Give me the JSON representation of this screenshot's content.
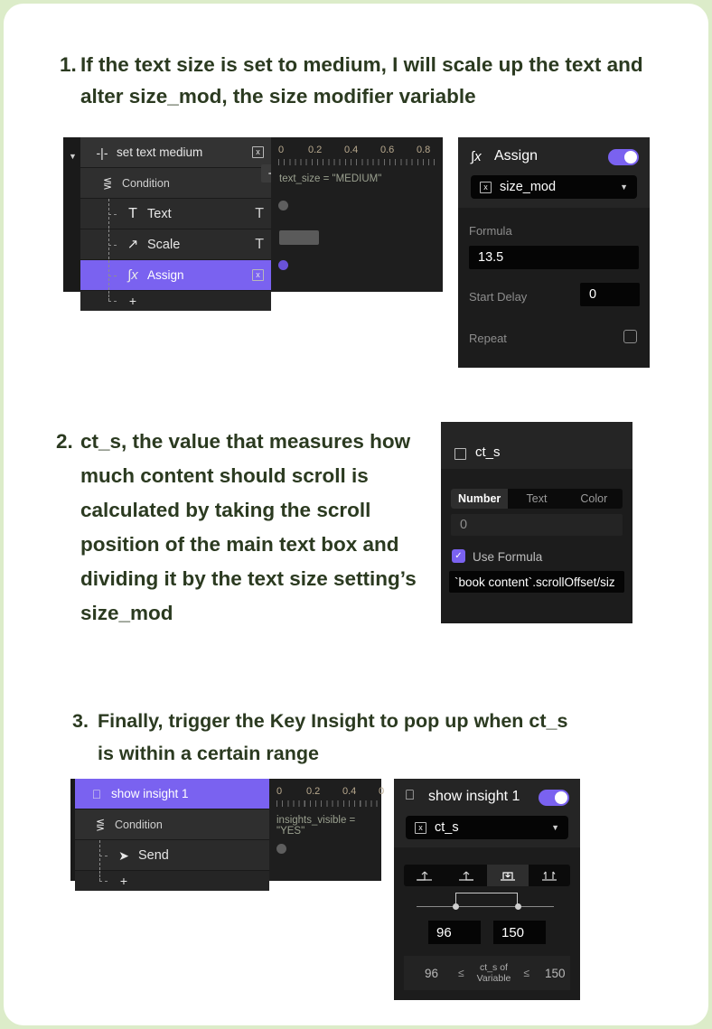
{
  "steps": [
    {
      "num": "1.",
      "text": "If the text size is set to medium, I will scale up the text and alter size_mod, the size modifier variable"
    },
    {
      "num": "2.",
      "text": "ct_s, the value that measures how much content should scroll is calculated by taking the scroll position of the main text box and dividing it by the text size setting’s size_mod"
    },
    {
      "num": "3.",
      "text": "Finally, trigger the Key Insight to pop up when ct_s is within a certain range"
    }
  ],
  "panel1": {
    "tree": {
      "caret": "▼",
      "rows": [
        {
          "icon": "-|-",
          "label": "set text medium",
          "tail_box": "x"
        },
        {
          "icon": "condition-icon",
          "label": "Condition"
        },
        {
          "icon": "T",
          "label": "Text",
          "tail": "T"
        },
        {
          "icon": "↗",
          "label": "Scale",
          "tail": "T"
        },
        {
          "icon": "∫x",
          "label": "Assign",
          "tail_box": "x"
        }
      ],
      "add_label": "+",
      "add_button_label": "+"
    },
    "ruler": {
      "ticks": [
        "0",
        "0.2",
        "0.4",
        "0.6",
        "0.8"
      ]
    },
    "condition_text": "text_size = \"MEDIUM\""
  },
  "assign_inspector": {
    "icon": "∫x",
    "title": "Assign",
    "toggle_on": true,
    "variable": "size_mod",
    "formula_label": "Formula",
    "formula_value": "13.5",
    "start_delay_label": "Start Delay",
    "start_delay_value": "0",
    "repeat_label": "Repeat",
    "repeat_checked": false
  },
  "cts_inspector": {
    "title": "ct_s",
    "tabs": [
      "Number",
      "Text",
      "Color"
    ],
    "active_tab": "Number",
    "value": "0",
    "use_formula_label": "Use Formula",
    "use_formula_checked": true,
    "formula_value": "`book content`.scrollOffset/siz"
  },
  "panel3": {
    "tree": {
      "rows": [
        {
          "icon": "insight-icon",
          "label": "show insight 1",
          "selected": true
        },
        {
          "icon": "condition-icon",
          "label": "Condition"
        },
        {
          "icon": "➤",
          "label": "Send"
        }
      ],
      "add_label": "+"
    },
    "ruler": {
      "ticks": [
        "0",
        "0.2",
        "0.4",
        "0"
      ]
    },
    "condition_text": "insights_visible = \"YES\""
  },
  "insight_inspector": {
    "title": "show insight 1",
    "toggle_on": true,
    "variable": "ct_s",
    "modes": [
      "enter-up",
      "enter-down",
      "range",
      "exit"
    ],
    "active_mode": "range",
    "range_min": "96",
    "range_max": "150",
    "summary": {
      "min": "96",
      "op_left": "≤",
      "variable_line1": "ct_s of",
      "variable_line2": "Variable",
      "op_right": "≤",
      "max": "150"
    }
  },
  "colors": {
    "page_bg": "#dcecc9",
    "card_bg": "#ffffff",
    "text": "#2b3a20",
    "accent": "#7a62f0",
    "panel_bg": "#1c1c1c"
  }
}
